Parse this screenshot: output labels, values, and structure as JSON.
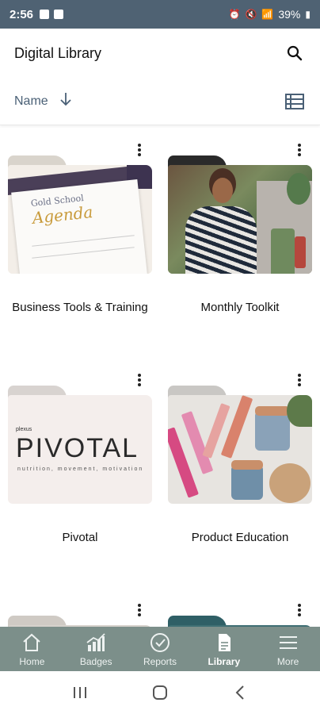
{
  "status_bar": {
    "time": "2:56",
    "battery": "39%"
  },
  "header": {
    "title": "Digital Library",
    "search_icon": "search-icon"
  },
  "sort": {
    "label": "Name",
    "direction_icon": "arrow-down-icon",
    "view_icon": "list-view-icon"
  },
  "folders": [
    {
      "title": "Business Tools & Training",
      "thumb_text_1": "Gold School",
      "thumb_text_2": "Agenda"
    },
    {
      "title": "Monthly Toolkit"
    },
    {
      "title": "Pivotal",
      "thumb_brand": "plexus",
      "thumb_word": "PIVOTAL",
      "thumb_tagline": "nutrition, movement, motivation"
    },
    {
      "title": "Product Education"
    },
    {
      "title": ""
    },
    {
      "title": ""
    }
  ],
  "nav": {
    "items": [
      {
        "label": "Home",
        "icon": "home-icon"
      },
      {
        "label": "Badges",
        "icon": "chart-icon"
      },
      {
        "label": "Reports",
        "icon": "check-circle-icon"
      },
      {
        "label": "Library",
        "icon": "document-icon"
      },
      {
        "label": "More",
        "icon": "menu-icon"
      }
    ],
    "active": "Library"
  },
  "colors": {
    "status_bar": "#4f6273",
    "nav_bg": "#7c8f8a",
    "accent": "#4a6076"
  }
}
